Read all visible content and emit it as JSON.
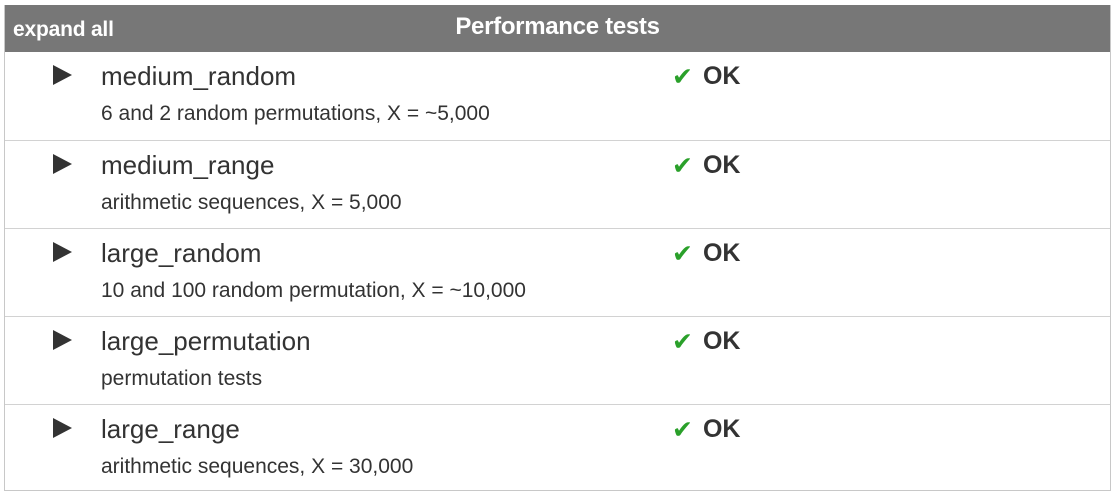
{
  "header": {
    "expand_label": "expand all",
    "title": "Performance tests"
  },
  "tests": [
    {
      "name": "medium_random",
      "description": "6 and 2 random permutations, X = ~5,000",
      "status": "OK"
    },
    {
      "name": "medium_range",
      "description": "arithmetic sequences, X = 5,000",
      "status": "OK"
    },
    {
      "name": "large_random",
      "description": "10 and 100 random permutation, X = ~10,000",
      "status": "OK"
    },
    {
      "name": "large_permutation",
      "description": "permutation tests",
      "status": "OK"
    },
    {
      "name": "large_range",
      "description": "arithmetic sequences, X = 30,000",
      "status": "OK"
    }
  ],
  "icons": {
    "toggle": "triangle-right-icon",
    "status": "checkmark-icon"
  },
  "colors": {
    "header_bg": "#777777",
    "check_green": "#2aa02a",
    "text": "#333333"
  }
}
